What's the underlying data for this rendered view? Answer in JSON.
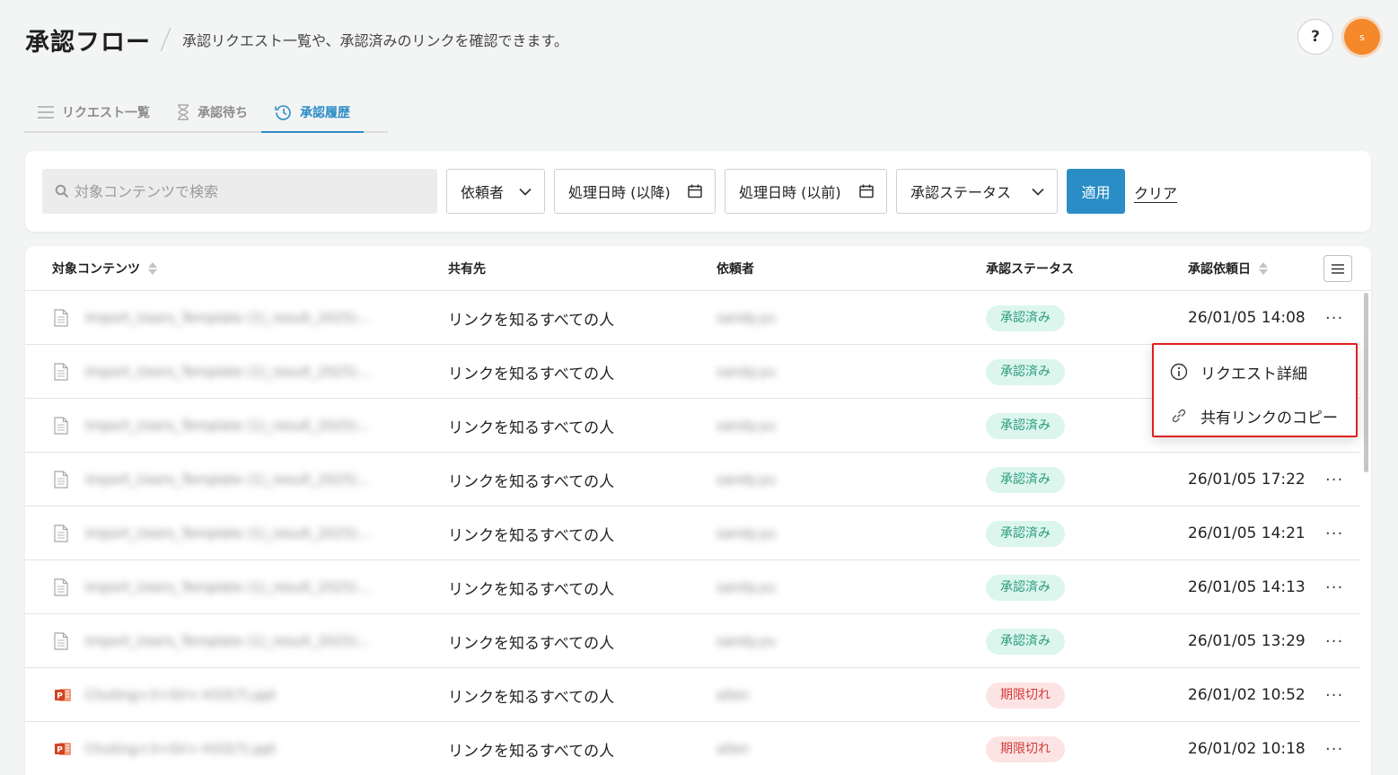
{
  "header": {
    "title": "承認フロー",
    "subtitle": "承認リクエスト一覧や、承認済みのリンクを確認できます。",
    "help_label": "?",
    "avatar_initial": "s"
  },
  "tabs": [
    {
      "label": "リクエスト一覧",
      "icon": "list-icon",
      "active": false
    },
    {
      "label": "承認待ち",
      "icon": "hourglass-icon",
      "active": false
    },
    {
      "label": "承認履歴",
      "icon": "history-icon",
      "active": true
    }
  ],
  "filters": {
    "search_placeholder": "対象コンテンツで検索",
    "requester_label": "依頼者",
    "date_after_label": "処理日時 (以降)",
    "date_before_label": "処理日時 (以前)",
    "status_label": "承認ステータス",
    "apply_label": "適用",
    "clear_label": "クリア"
  },
  "table": {
    "columns": {
      "content": "対象コンテンツ",
      "share": "共有先",
      "requester": "依頼者",
      "status": "承認ステータス",
      "requested_date": "承認依頼日"
    },
    "rows": [
      {
        "file_type": "document",
        "name": "Import_Users_Template (1)_result_2025)…",
        "share": "リンクを知るすべての人",
        "requester": "sandy.yu",
        "status": "承認済み",
        "status_kind": "approved",
        "date": "26/01/05 14:08",
        "more": "···"
      },
      {
        "file_type": "document",
        "name": "Import_Users_Template (1)_result_2025)…",
        "share": "リンクを知るすべての人",
        "requester": "sandy.yu",
        "status": "承認済み",
        "status_kind": "approved",
        "date": "",
        "more": ""
      },
      {
        "file_type": "document",
        "name": "Import_Users_Template (1)_result_2025)…",
        "share": "リンクを知るすべての人",
        "requester": "sandy.yu",
        "status": "承認済み",
        "status_kind": "approved",
        "date": "",
        "more": ""
      },
      {
        "file_type": "document",
        "name": "Import_Users_Template (1)_result_2025)…",
        "share": "リンクを知るすべての人",
        "requester": "sandy.yu",
        "status": "承認済み",
        "status_kind": "approved",
        "date": "26/01/05 17:22",
        "more": "···"
      },
      {
        "file_type": "document",
        "name": "Import_Users_Template (1)_result_2025)…",
        "share": "リンクを知るすべての人",
        "requester": "sandy.yu",
        "status": "承認済み",
        "status_kind": "approved",
        "date": "26/01/05 14:21",
        "more": "···"
      },
      {
        "file_type": "document",
        "name": "Import_Users_Template (1)_result_2025)…",
        "share": "リンクを知るすべての人",
        "requester": "sandy.yu",
        "status": "承認済み",
        "status_kind": "approved",
        "date": "26/01/05 14:13",
        "more": "···"
      },
      {
        "file_type": "document",
        "name": "Import_Users_Template (1)_result_2025)…",
        "share": "リンクを知るすべての人",
        "requester": "sandy.yu",
        "status": "承認済み",
        "status_kind": "approved",
        "date": "26/01/05 13:29",
        "more": "···"
      },
      {
        "file_type": "powerpoint",
        "name": "Chuting+3+SV+-H33(7).ppt",
        "share": "リンクを知るすべての人",
        "requester": "allen",
        "status": "期限切れ",
        "status_kind": "expired",
        "date": "26/01/02 10:52",
        "more": "···"
      },
      {
        "file_type": "powerpoint",
        "name": "Chuting+3+SV+-H33(7).ppt",
        "share": "リンクを知るすべての人",
        "requester": "allen",
        "status": "期限切れ",
        "status_kind": "expired",
        "date": "26/01/02 10:18",
        "more": "···"
      }
    ]
  },
  "context_menu": {
    "items": [
      {
        "label": "リクエスト詳細",
        "icon": "info-icon"
      },
      {
        "label": "共有リンクのコピー",
        "icon": "link-icon"
      }
    ]
  },
  "colors": {
    "accent": "#2a8dc6",
    "approved_bg": "#dcf6ee",
    "approved_text": "#2a9a7a",
    "expired_bg": "#fde4e4",
    "expired_text": "#d33b3b",
    "avatar": "#f5882a",
    "highlight_border": "#e02020"
  }
}
